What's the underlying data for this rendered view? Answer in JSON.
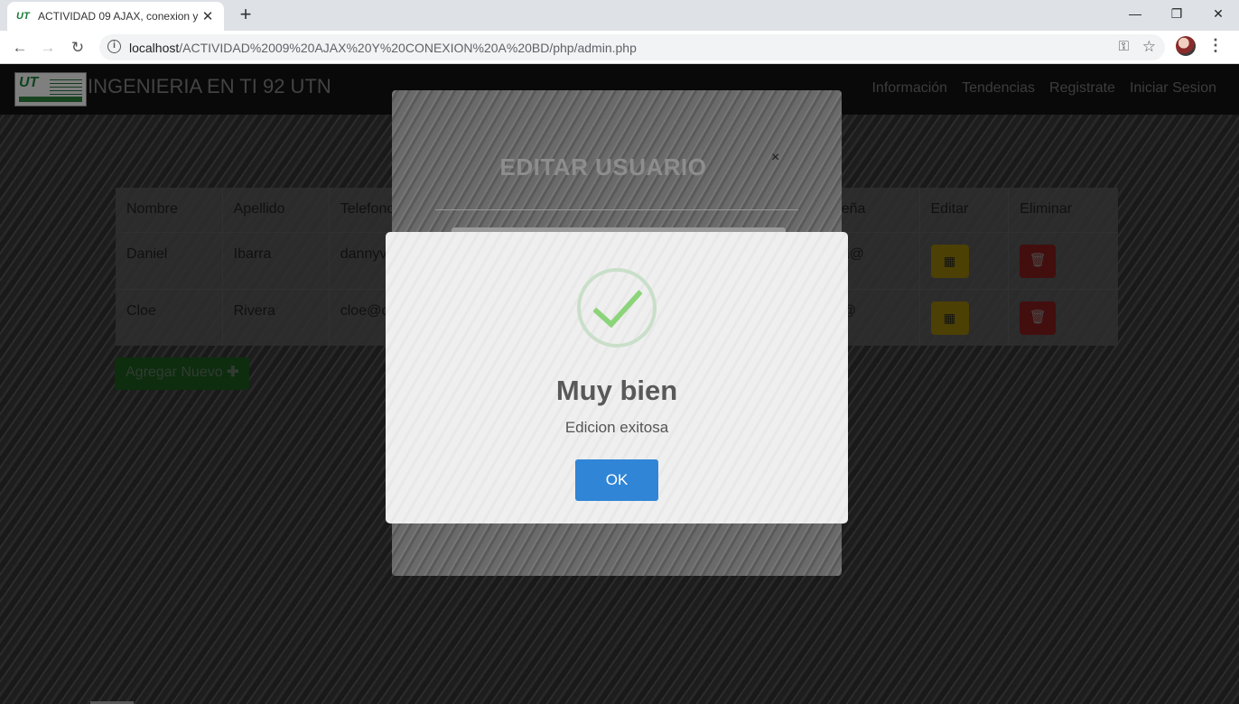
{
  "browser": {
    "tab_favicon": "UT",
    "tab_title": "ACTIVIDAD 09 AJAX, conexion y c",
    "tab_close": "✕",
    "new_tab": "+",
    "url_host": "localhost",
    "url_path": "/ACTIVIDAD%2009%20AJAX%20Y%20CONEXION%20A%20BD/php/admin.php"
  },
  "navbar": {
    "logo_text": "UT",
    "brand": "INGENIERIA EN TI 92 UTN",
    "links": [
      "Información",
      "Tendencias",
      "Registrate",
      "Iniciar Sesion"
    ]
  },
  "table": {
    "headers": [
      "Nombre",
      "Apellido",
      "Telefono",
      "",
      "",
      "",
      "eña",
      "Editar",
      "Eliminar"
    ],
    "rows": [
      {
        "nombre": "Daniel",
        "apellido": "Ibarra",
        "telefono": "dannyv",
        "contrasena": "a@"
      },
      {
        "nombre": "Cloe",
        "apellido": "Rivera",
        "telefono": "cloe@c",
        "contrasena": "@"
      }
    ]
  },
  "add_button": {
    "label": "Agregar Nuevo",
    "icon": "plus-icon"
  },
  "edit_modal": {
    "title": "EDITAR USUARIO",
    "close": "×"
  },
  "alert": {
    "icon": "success-check-icon",
    "title": "Muy bien",
    "text": "Edicion exitosa",
    "ok_label": "OK",
    "ok_color": "#3085d6",
    "check_color": "#8cd47a"
  },
  "colors": {
    "edit_button": "#8a7608",
    "delete_button": "#7a1a1a",
    "add_button": "#18521a"
  }
}
